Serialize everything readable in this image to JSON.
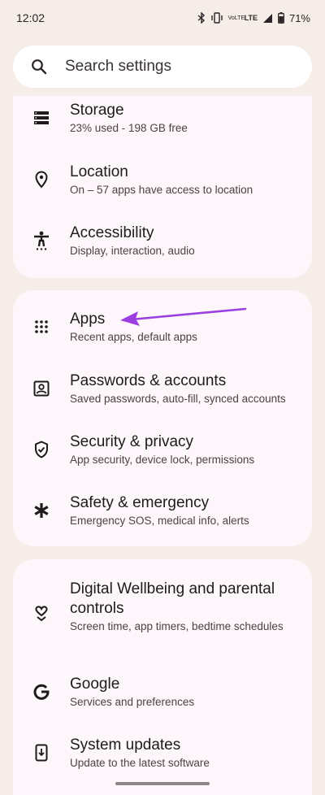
{
  "status_bar": {
    "time": "12:02",
    "volte_label": "VoLTE",
    "lte_label": "LTE",
    "battery": "71%"
  },
  "search": {
    "placeholder": "Search settings"
  },
  "group1": [
    {
      "title": "Storage",
      "subtitle": "23% used - 198 GB free",
      "icon": "storage-icon"
    },
    {
      "title": "Location",
      "subtitle": "On – 57 apps have access to location",
      "icon": "location-pin-icon"
    },
    {
      "title": "Accessibility",
      "subtitle": "Display, interaction, audio",
      "icon": "accessibility-icon"
    }
  ],
  "group2": [
    {
      "title": "Apps",
      "subtitle": "Recent apps, default apps",
      "icon": "apps-grid-icon"
    },
    {
      "title": "Passwords & accounts",
      "subtitle": "Saved passwords, auto-fill, synced accounts",
      "icon": "account-box-icon"
    },
    {
      "title": "Security & privacy",
      "subtitle": "App security, device lock, permissions",
      "icon": "shield-check-icon"
    },
    {
      "title": "Safety & emergency",
      "subtitle": "Emergency SOS, medical info, alerts",
      "icon": "asterisk-icon"
    }
  ],
  "group3": [
    {
      "title": "Digital Wellbeing and parental controls",
      "subtitle": "Screen time, app timers, bedtime schedules",
      "icon": "wellbeing-heart-icon"
    },
    {
      "title": "Google",
      "subtitle": "Services and preferences",
      "icon": "google-g-icon"
    },
    {
      "title": "System updates",
      "subtitle": "Update to the latest software",
      "icon": "system-update-icon"
    }
  ],
  "colors": {
    "background": "#f6ece8",
    "card": "#fdf6fa",
    "annotation_arrow": "#9b3fe0"
  }
}
